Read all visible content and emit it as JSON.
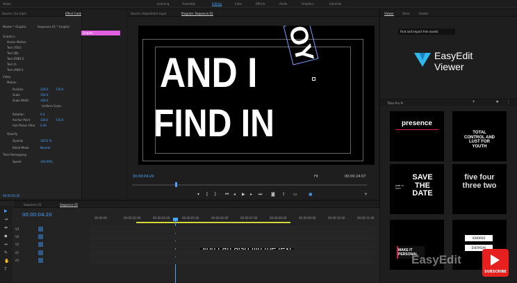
{
  "topbar": {
    "left_menu": "Home",
    "workspaces": [
      "Learning",
      "Assembly",
      "Editing",
      "Color",
      "Effects",
      "Audio",
      "Graphics",
      "Libraries"
    ],
    "active": "Editing"
  },
  "effect_controls": {
    "tabs": [
      "Source: (no clips)",
      "Effect Controls",
      "Essential Graphics",
      "Audio Clip Mixer: Sequence 01"
    ],
    "active_tab": "Effect Controls",
    "master_label": "Master * Graphic",
    "sequence_label": "Sequence 01 * Graphic",
    "clip_label": "Graphic",
    "timecode": "00:00:04:20",
    "rows": [
      {
        "label": "Graphics"
      },
      {
        "label": "Vector Motion"
      },
      {
        "label": "Text (YOU)"
      },
      {
        "label": "Text (IN)"
      },
      {
        "label": "Text (FIND I)"
      },
      {
        "label": "Text (I)"
      },
      {
        "label": "Text (AND I)"
      },
      {
        "label": "Video"
      },
      {
        "label": "Motion"
      },
      {
        "label": "Position",
        "v1": "328.0",
        "v2": "720.0"
      },
      {
        "label": "Scale",
        "v1": "100.0"
      },
      {
        "label": "Scale Width",
        "v1": "100.0"
      },
      {
        "label": "Uniform Scale"
      },
      {
        "label": "Rotation",
        "v1": "0.0"
      },
      {
        "label": "Anchor Point",
        "v1": "328.0",
        "v2": "720.0"
      },
      {
        "label": "Anti-flicker Filter",
        "v1": "0.00"
      },
      {
        "label": "Opacity"
      },
      {
        "label": "Opacity",
        "v1": "100.0 %"
      },
      {
        "label": "Blend Mode",
        "v1": "Normal"
      },
      {
        "label": "Time Remapping"
      },
      {
        "label": "Speed",
        "v1": "100.00%"
      }
    ]
  },
  "program": {
    "tab_source": "Source: Adjustment Layer",
    "tab_program": "Program: Sequence 02",
    "text_line1": "AND I",
    "text_rotated": "YOU",
    "text_line2": "FIND IN",
    "timecode_left": "00:00:04:20",
    "fit": "Fit",
    "timecode_right": "00:00:24:07"
  },
  "right_panel": {
    "tabs": [
      "Viewer",
      "Store",
      "Assets"
    ],
    "tooltip": "Find and import free assets",
    "logo_line1": "EasyEdit",
    "logo_line2": "Viewer",
    "section": "Titles Pro Pr",
    "cards": [
      {
        "name": "presence",
        "text": "presence"
      },
      {
        "name": "total-control",
        "text": "TOTAL CONTROL AND LUST FOR YOUTH"
      },
      {
        "name": "save-the-date",
        "text": "SAVE THE DATE"
      },
      {
        "name": "five-four-three-two",
        "text": "five four three two"
      },
      {
        "name": "make-it-personal",
        "text": "MAKE IT PERSONAL"
      },
      {
        "name": "ignored",
        "text": "IGNORED"
      }
    ],
    "card_small_text": "JUNE 15 2023",
    "card6_lower": "EVERYDAY"
  },
  "timeline": {
    "tabs": [
      "Sequence 01",
      "Sequence 02"
    ],
    "active_tab": "Sequence 02",
    "timecode": "00:00:04:20",
    "ruler": [
      "00:00:00",
      "00:00:02:00",
      "00:00:04:00",
      "00:00:05:00",
      "00:00:06:00",
      "00:00:07:00",
      "00:00:08:00",
      "00:00:09:00",
      "00:00:10:00",
      "00:00:11:00"
    ],
    "tracks": [
      "V3",
      "V2",
      "V1",
      "A1",
      "A2"
    ],
    "clips": [
      {
        "label": "AEX"
      },
      {
        "label": "RED"
      }
    ],
    "subtitle": "you can also flip the text"
  },
  "watermark": {
    "brand": "EasyEdit",
    "subscribe": "SUBSCRIBE"
  },
  "colors": {
    "accent": "#4aa3ff",
    "clip_pink": "#e060e0",
    "clip_purple": "#8a5cc8",
    "subscribe_red": "#e5201e"
  }
}
